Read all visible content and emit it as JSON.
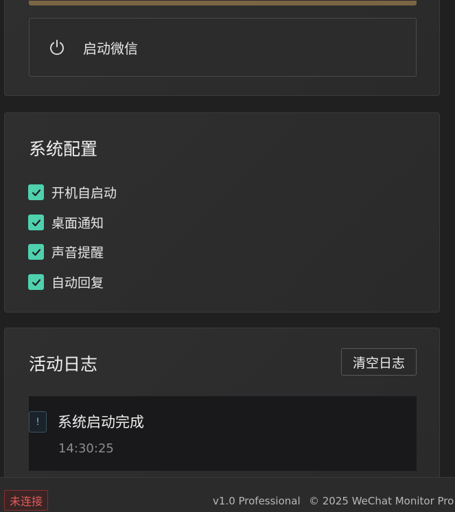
{
  "launch": {
    "button_label": "启动微信",
    "icon": "power-icon"
  },
  "settings": {
    "title": "系统配置",
    "options": [
      {
        "label": "开机自启动",
        "checked": true
      },
      {
        "label": "桌面通知",
        "checked": true
      },
      {
        "label": "声音提醒",
        "checked": true
      },
      {
        "label": "自动回复",
        "checked": true
      }
    ]
  },
  "log": {
    "title": "活动日志",
    "clear_label": "清空日志",
    "entries": [
      {
        "icon_text": "!",
        "message": "系统启动完成",
        "time": "14:30:25"
      }
    ]
  },
  "statusbar": {
    "connection_status": "未连接",
    "version": "v1.0 Professional",
    "copyright": "© 2025 WeChat Monitor Pro"
  },
  "colors": {
    "accent": "#4fd1ae",
    "gold": "#7a6545",
    "error": "#e25b5b",
    "background": "#202020"
  }
}
